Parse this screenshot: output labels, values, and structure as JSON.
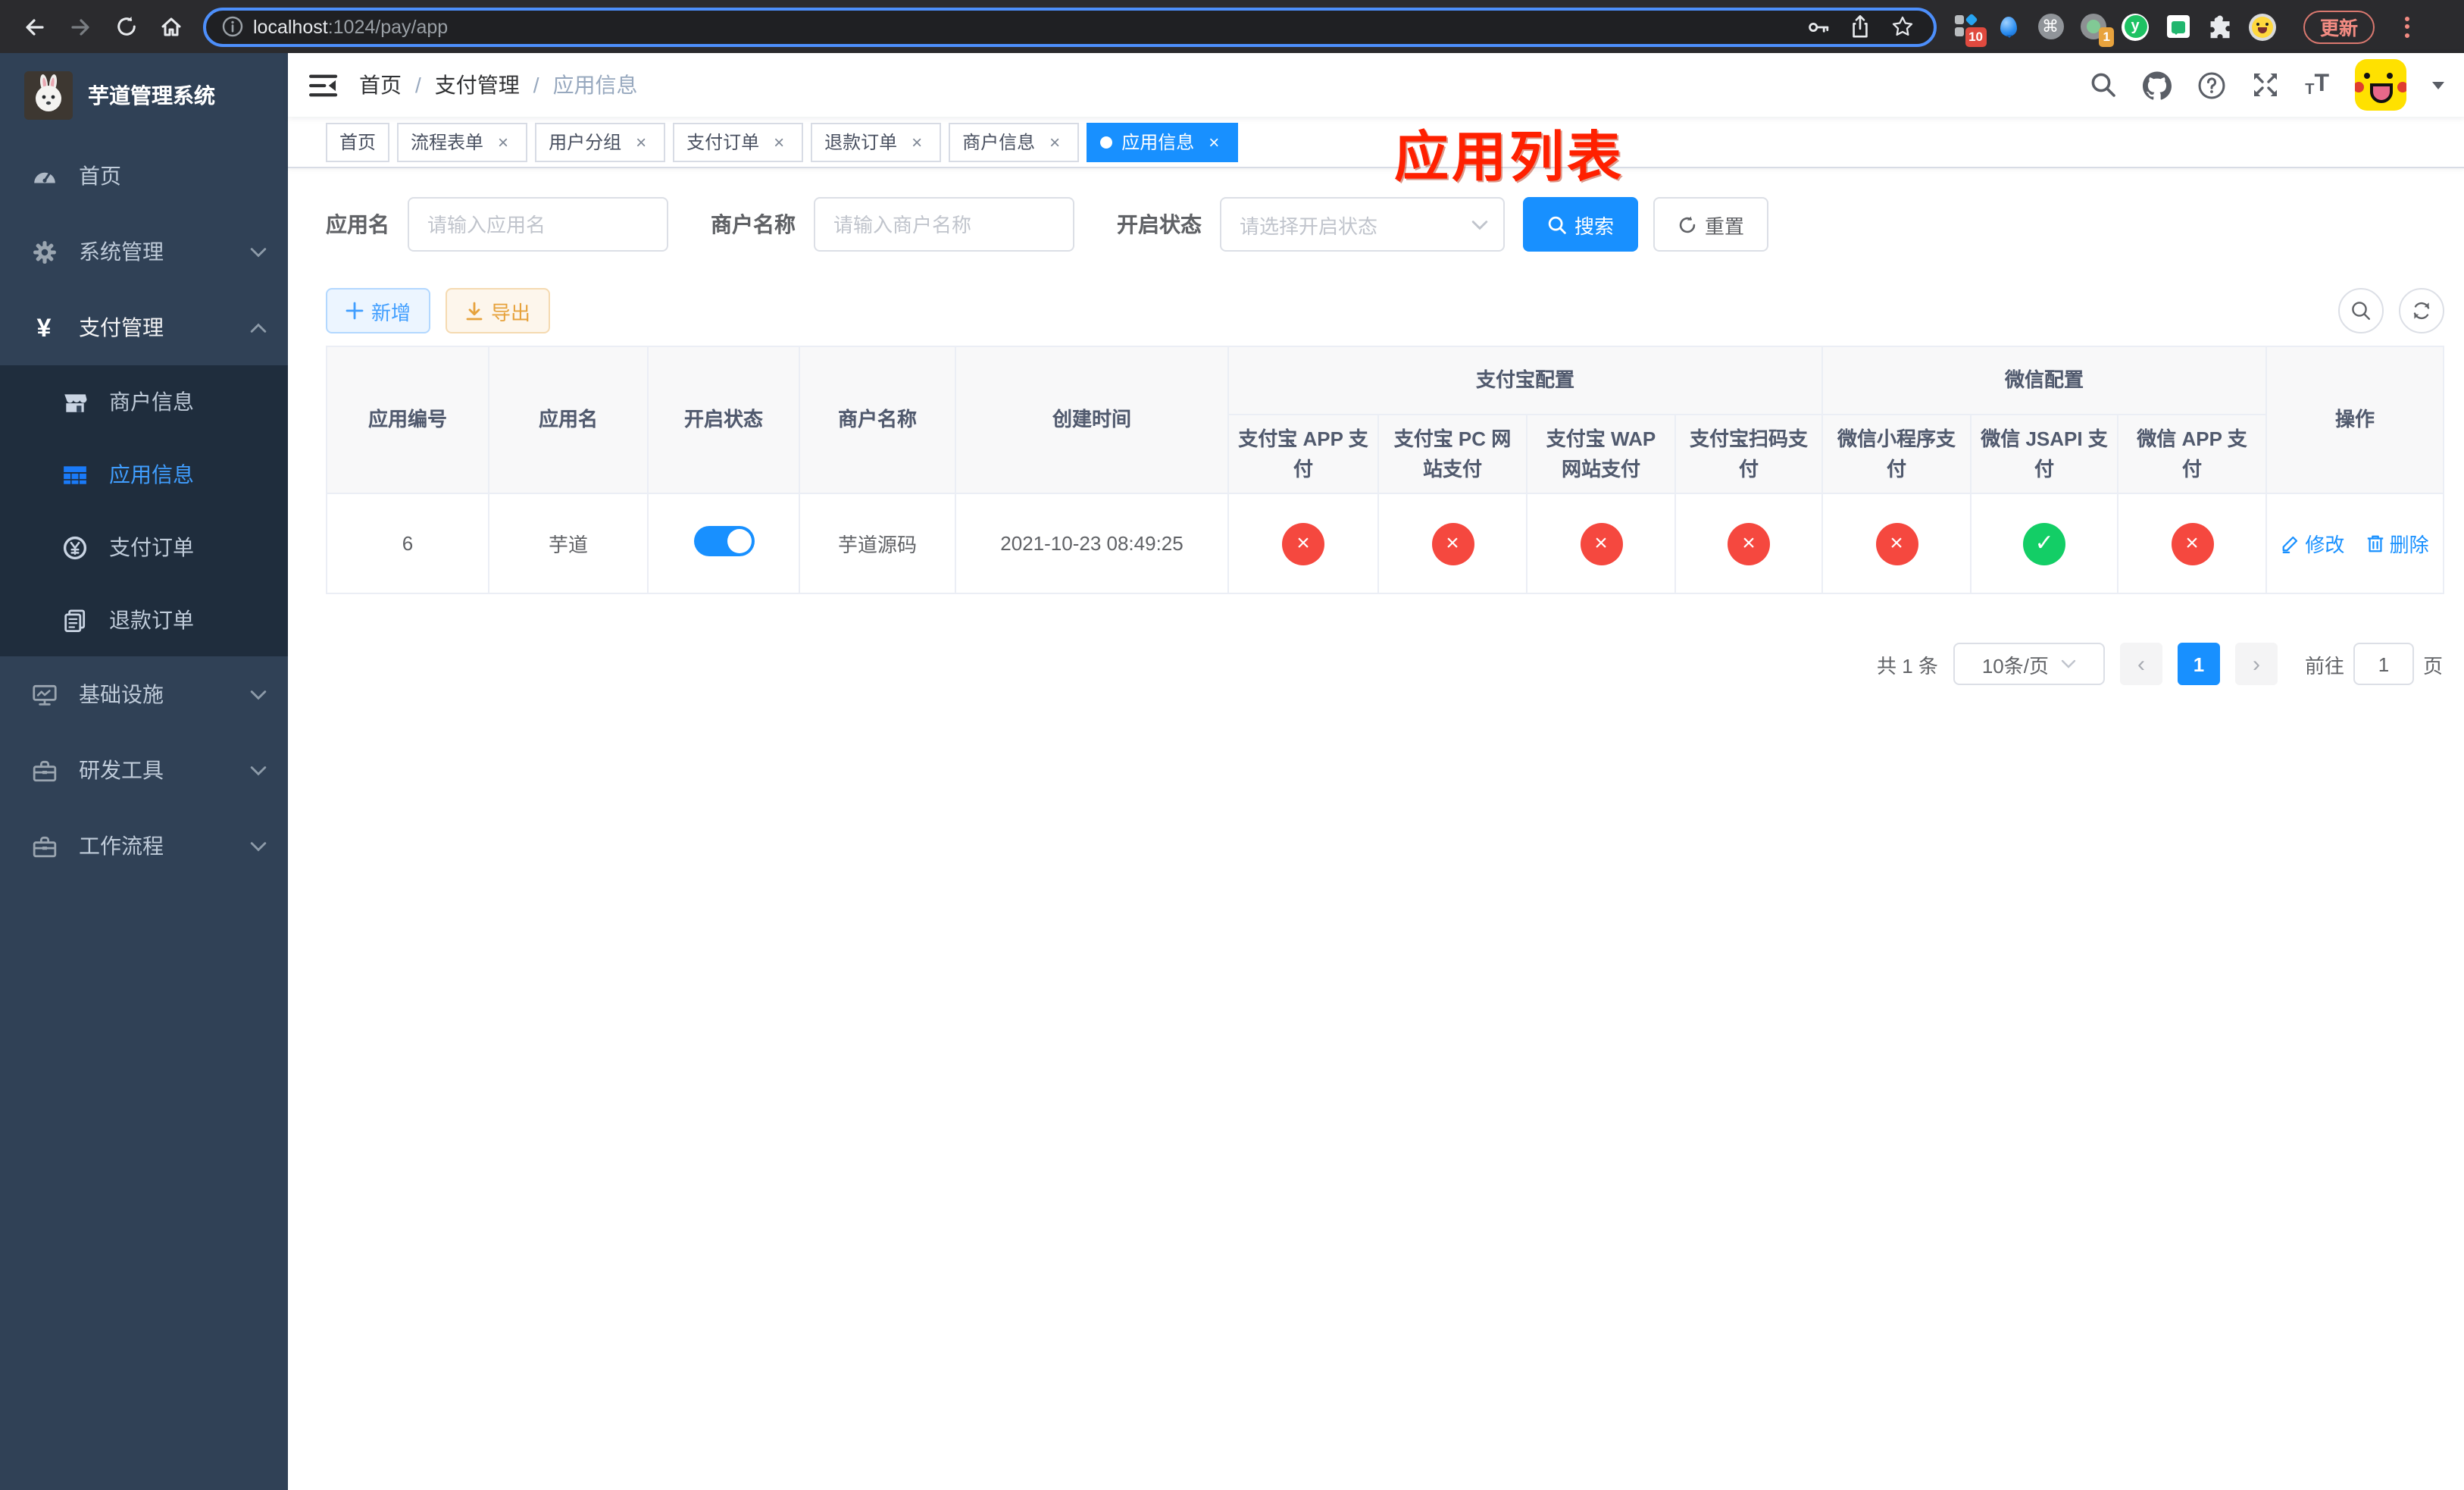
{
  "colors": {
    "accent": "#1890ff",
    "sidebar_bg": "#304156",
    "submenu_bg": "#1f2d3d",
    "status_enabled": "#13ce66",
    "status_disabled": "#f5483f",
    "annotation_red": "#ff2000",
    "export_warning": "#e6a23c",
    "update_button_red": "#f28b82"
  },
  "glyphs": {
    "close": "×",
    "check": "✓",
    "cross": "×",
    "slash": "/",
    "prev": "‹",
    "next": "›",
    "command": "⌘",
    "star": "☆",
    "y_logo": "y"
  },
  "browser": {
    "url_host": "localhost",
    "url_path": ":1024/pay/app",
    "update_button": "更新",
    "extension_badge_blocks": "10",
    "extension_badge_record": "1"
  },
  "annotation": "应用列表",
  "sidebar": {
    "title": "芋道管理系统",
    "menu": [
      {
        "label": "首页"
      },
      {
        "label": "系统管理"
      },
      {
        "label": "支付管理"
      }
    ],
    "submenu": [
      {
        "label": "商户信息"
      },
      {
        "label": "应用信息"
      },
      {
        "label": "支付订单"
      },
      {
        "label": "退款订单"
      }
    ],
    "menu_bottom": [
      {
        "label": "基础设施"
      },
      {
        "label": "研发工具"
      },
      {
        "label": "工作流程"
      }
    ]
  },
  "header": {
    "breadcrumb": [
      "首页",
      "支付管理",
      "应用信息"
    ],
    "tt_small": "T",
    "tt_big": "T"
  },
  "tabs": {
    "items": [
      {
        "label": "首页"
      },
      {
        "label": "流程表单"
      },
      {
        "label": "用户分组"
      },
      {
        "label": "支付订单"
      },
      {
        "label": "退款订单"
      },
      {
        "label": "商户信息"
      },
      {
        "label": "应用信息"
      }
    ]
  },
  "filters": {
    "app_name": {
      "label": "应用名",
      "placeholder": "请输入应用名"
    },
    "merchant_name": {
      "label": "商户名称",
      "placeholder": "请输入商户名称"
    },
    "status": {
      "label": "开启状态",
      "placeholder": "请选择开启状态"
    },
    "search_button": "搜索",
    "reset_button": "重置"
  },
  "toolbar": {
    "add_button": "新增",
    "export_button": "导出"
  },
  "table": {
    "group_headers": {
      "alipay": "支付宝配置",
      "wechat": "微信配置"
    },
    "columns": [
      "应用编号",
      "应用名",
      "开启状态",
      "商户名称",
      "创建时间",
      "支付宝 APP 支付",
      "支付宝 PC 网站支付",
      "支付宝 WAP 网站支付",
      "支付宝扫码支付",
      "微信小程序支付",
      "微信 JSAPI 支付",
      "微信 APP 支付",
      "操作"
    ],
    "rows": [
      {
        "id": "6",
        "name": "芋道",
        "enabled": true,
        "merchant": "芋道源码",
        "created_at": "2021-10-23 08:49:25",
        "statuses": [
          "disabled",
          "disabled",
          "disabled",
          "disabled",
          "disabled",
          "enabled",
          "disabled"
        ],
        "actions": [
          "修改",
          "删除"
        ]
      }
    ]
  },
  "pagination": {
    "total": "共 1 条",
    "page_size": "10条/页",
    "current_page": "1",
    "goto_label": "前往",
    "goto_value": "1",
    "goto_suffix": "页"
  }
}
